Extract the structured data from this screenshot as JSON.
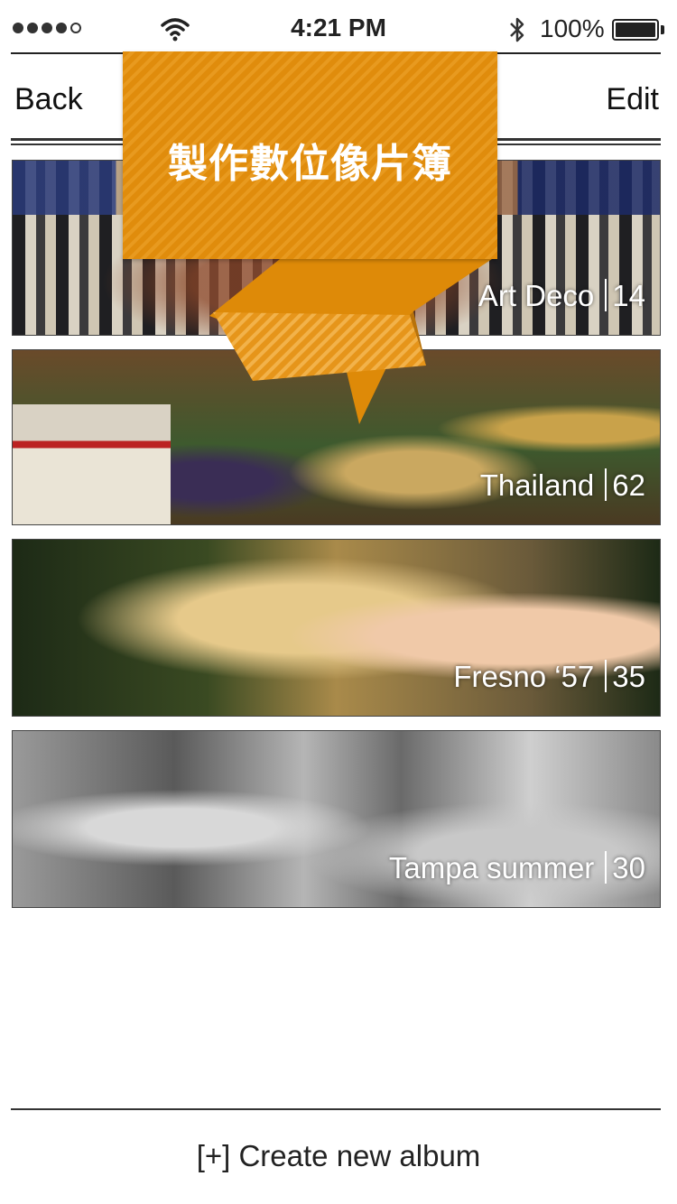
{
  "status_bar": {
    "time": "4:21 PM",
    "battery_percent": "100%",
    "signal_bars_filled": 4,
    "signal_bars_total": 5,
    "icons": [
      "wifi-icon",
      "bluetooth-icon",
      "battery-icon"
    ]
  },
  "nav": {
    "back_label": "Back",
    "edit_label": "Edit"
  },
  "promo": {
    "title": "製作數位像片簿",
    "color": "#e08c0c"
  },
  "albums": [
    {
      "name": "Art Deco",
      "count": "14"
    },
    {
      "name": "Thailand",
      "count": "62"
    },
    {
      "name": "Fresno ‘57",
      "count": "35"
    },
    {
      "name": "Tampa summer",
      "count": "30"
    }
  ],
  "footer": {
    "create_label": "[+] Create new album"
  }
}
